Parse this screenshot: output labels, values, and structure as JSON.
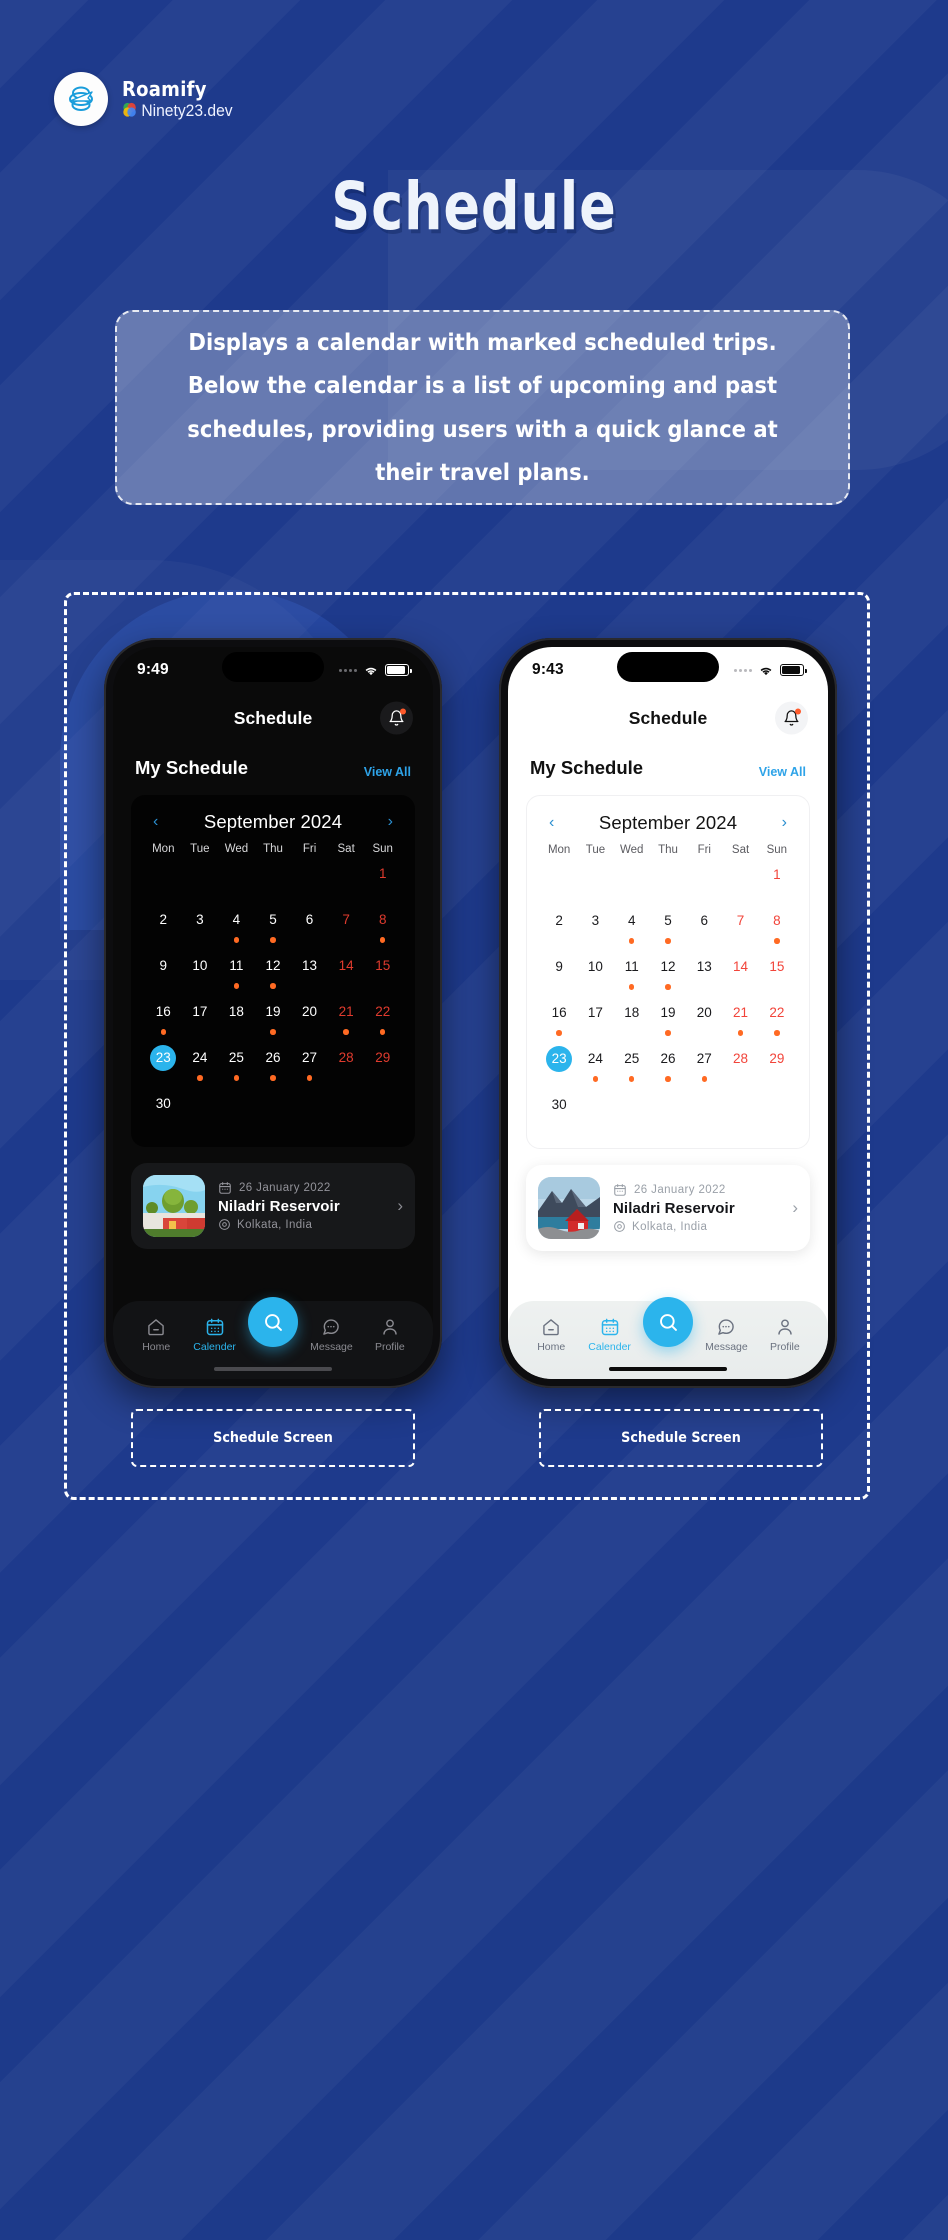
{
  "brand": {
    "name": "Roamify",
    "sub": "Ninety23.dev",
    "logo_icon": "globe-travel-icon"
  },
  "page": {
    "title": "Schedule",
    "description": "Displays a calendar with marked scheduled trips. Below the calendar is a list of upcoming and past schedules, providing users with a quick glance at their travel plans."
  },
  "colors": {
    "background": "#1e3a8c",
    "accent": "#2bb4ec",
    "link": "#2ea3e8",
    "dot": "#ff6a23",
    "weekend_dark": "#e03b2e",
    "weekend_light": "#f2443a",
    "notification_dot": "#ff5a2b",
    "panel_dark": "#0a0a0a",
    "panel_light": "#ffffff"
  },
  "phones": [
    {
      "theme": "dark",
      "caption": "Schedule Screen",
      "status": {
        "time": "9:49",
        "wifi_icon": "wifi-icon",
        "battery_icon": "battery-icon",
        "signal_icon": "signal-dots-icon"
      },
      "header": {
        "title": "Schedule",
        "bell_icon": "bell-icon"
      },
      "section": {
        "title": "My Schedule",
        "view_all": "View All"
      },
      "calendar": {
        "month": "September 2024",
        "prev_icon": "chevron-left-icon",
        "next_icon": "chevron-right-icon",
        "weekdays": [
          "Mon",
          "Tue",
          "Wed",
          "Thu",
          "Fri",
          "Sat",
          "Sun"
        ],
        "selected_day": 23,
        "marked_days": [
          4,
          5,
          8,
          11,
          12,
          16,
          19,
          21,
          22,
          24,
          25,
          26,
          27
        ],
        "weekend_columns": [
          5,
          6
        ],
        "lead_blanks": 6,
        "days_in_month": 30
      },
      "trip": {
        "date": "26 January 2022",
        "name": "Niladri Reservoir",
        "location": "Kolkata, India",
        "calendar_icon": "calendar-icon",
        "pin_icon": "location-pin-icon",
        "chevron_icon": "chevron-right-icon",
        "thumb_icon": "house-garden-thumbnail"
      },
      "tabs": [
        {
          "label": "Home",
          "icon": "home-icon",
          "active": false
        },
        {
          "label": "Calender",
          "icon": "calendar-icon",
          "active": true
        },
        {
          "label": "",
          "icon": "search-icon",
          "active": false
        },
        {
          "label": "Message",
          "icon": "message-icon",
          "active": false
        },
        {
          "label": "Profile",
          "icon": "profile-icon",
          "active": false
        }
      ]
    },
    {
      "theme": "light",
      "caption": "Schedule Screen",
      "status": {
        "time": "9:43",
        "wifi_icon": "wifi-icon",
        "battery_icon": "battery-icon",
        "signal_icon": "signal-dots-icon"
      },
      "header": {
        "title": "Schedule",
        "bell_icon": "bell-icon"
      },
      "section": {
        "title": "My Schedule",
        "view_all": "View All"
      },
      "calendar": {
        "month": "September 2024",
        "prev_icon": "chevron-left-icon",
        "next_icon": "chevron-right-icon",
        "weekdays": [
          "Mon",
          "Tue",
          "Wed",
          "Thu",
          "Fri",
          "Sat",
          "Sun"
        ],
        "selected_day": 23,
        "marked_days": [
          4,
          5,
          8,
          11,
          12,
          16,
          19,
          21,
          22,
          24,
          25,
          26,
          27
        ],
        "weekend_columns": [
          5,
          6
        ],
        "lead_blanks": 6,
        "days_in_month": 30
      },
      "trip": {
        "date": "26 January 2022",
        "name": "Niladri Reservoir",
        "location": "Kolkata, India",
        "calendar_icon": "calendar-icon",
        "pin_icon": "location-pin-icon",
        "chevron_icon": "chevron-right-icon",
        "thumb_icon": "mountain-cabin-thumbnail"
      },
      "tabs": [
        {
          "label": "Home",
          "icon": "home-icon",
          "active": false
        },
        {
          "label": "Calender",
          "icon": "calendar-icon",
          "active": true
        },
        {
          "label": "",
          "icon": "search-icon",
          "active": false
        },
        {
          "label": "Message",
          "icon": "message-icon",
          "active": false
        },
        {
          "label": "Profile",
          "icon": "profile-icon",
          "active": false
        }
      ]
    }
  ]
}
